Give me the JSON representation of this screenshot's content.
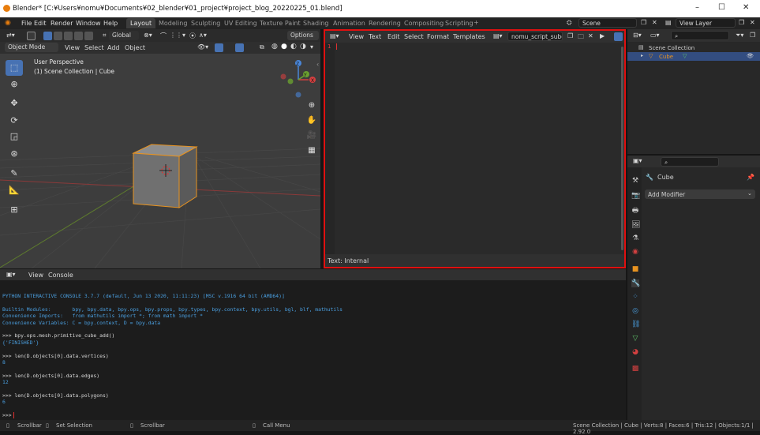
{
  "window": {
    "title": "Blender* [C:¥Users¥nomu¥Documents¥02_blender¥01_project¥project_blog_20220225_01.blend]",
    "controls": [
      "–",
      "☐",
      "✕"
    ]
  },
  "menubar": {
    "items": [
      "File",
      "Edit",
      "Render",
      "Window",
      "Help"
    ],
    "workspaces": [
      "Layout",
      "Modeling",
      "Sculpting",
      "UV Editing",
      "Texture Paint",
      "Shading",
      "Animation",
      "Rendering",
      "Compositing",
      "Scripting"
    ],
    "active_workspace": "Layout",
    "scene": "Scene",
    "view_layer": "View Layer"
  },
  "viewport": {
    "mode": "Object Mode",
    "menus": [
      "View",
      "Select",
      "Add",
      "Object"
    ],
    "transform_orientation": "Global",
    "options_label": "Options",
    "overlay_title": "User Perspective",
    "overlay_sub": "(1) Scene Collection | Cube",
    "gizmo_axes": [
      "X",
      "Y",
      "Z"
    ]
  },
  "text_editor": {
    "menus": [
      "View",
      "Text",
      "Edit",
      "Select",
      "Format",
      "Templates"
    ],
    "text_name": "nomu_script_subdiv",
    "line_number": "1",
    "footer": "Text: Internal"
  },
  "console": {
    "menus": [
      "View",
      "Console"
    ],
    "lines": [
      {
        "text": "PYTHON INTERACTIVE CONSOLE 3.7.7 (default, Jun 13 2020, 11:11:23) [MSC v.1916 64 bit (AMD64)]",
        "color": "#4a9fe0"
      },
      {
        "text": "",
        "color": "#4a9fe0"
      },
      {
        "text": "Builtin Modules:       bpy, bpy.data, bpy.ops, bpy.props, bpy.types, bpy.context, bpy.utils, bgl, blf, mathutils",
        "color": "#4a9fe0"
      },
      {
        "text": "Convenience Imports:   from mathutils import *; from math import *",
        "color": "#4a9fe0"
      },
      {
        "text": "Convenience Variables: C = bpy.context, D = bpy.data",
        "color": "#4a9fe0"
      },
      {
        "text": "",
        "color": "#4a9fe0"
      },
      {
        "text": ">>> bpy.ops.mesh.primitive_cube_add()",
        "color": "#d8d8d8"
      },
      {
        "text": "{'FINISHED'}",
        "color": "#4a9fe0"
      },
      {
        "text": "",
        "color": "#d8d8d8"
      },
      {
        "text": ">>> len(D.objects[0].data.vertices)",
        "color": "#d8d8d8"
      },
      {
        "text": "8",
        "color": "#4a9fe0"
      },
      {
        "text": "",
        "color": "#d8d8d8"
      },
      {
        "text": ">>> len(D.objects[0].data.edges)",
        "color": "#d8d8d8"
      },
      {
        "text": "12",
        "color": "#4a9fe0"
      },
      {
        "text": "",
        "color": "#d8d8d8"
      },
      {
        "text": ">>> len(D.objects[0].data.polygons)",
        "color": "#d8d8d8"
      },
      {
        "text": "6",
        "color": "#4a9fe0"
      },
      {
        "text": "",
        "color": "#d8d8d8"
      },
      {
        "text": ">>> ",
        "color": "#d8d8d8"
      }
    ]
  },
  "outliner": {
    "collection": "Scene Collection",
    "object": "Cube"
  },
  "properties": {
    "object": "Cube",
    "add_modifier": "Add Modifier"
  },
  "statusbar": {
    "left": [
      "Scrollbar",
      "Set Selection",
      "Scrollbar",
      "Call Menu"
    ],
    "right": "Scene Collection | Cube | Verts:8 | Faces:6 | Tris:12 | Objects:1/1 | 2.92.0"
  },
  "colors": {
    "accent": "#4772b3",
    "highlight_border": "#e01010",
    "selection": "#e89320",
    "console_info": "#4a9fe0"
  }
}
